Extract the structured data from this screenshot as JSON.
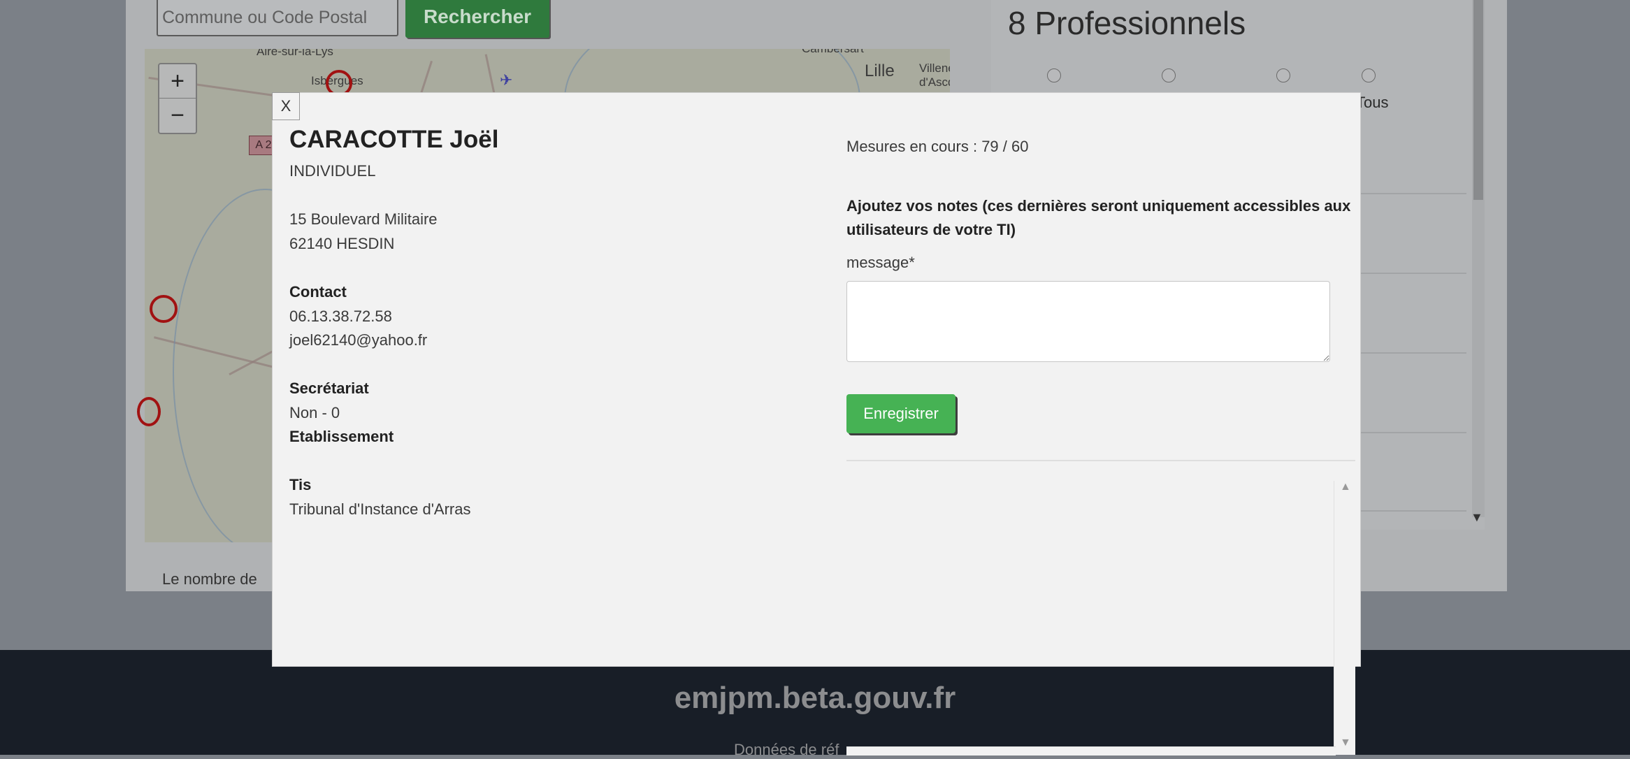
{
  "search": {
    "placeholder": "Commune ou Code Postal",
    "button_label": "Rechercher"
  },
  "map": {
    "zoom_in": "+",
    "zoom_out": "−",
    "road_sign": "A 2",
    "places": [
      "Aire-sur-la-Lys",
      "Isbergues",
      "Lille",
      "Villeneuve-d'Ascq",
      "Cambersart"
    ]
  },
  "below_map_text": "Le nombre de",
  "right_panel": {
    "title": "8 Professionnels",
    "radio_last_label": "Tous"
  },
  "footer": {
    "title": "emjpm.beta.gouv.fr",
    "subtitle": "Données de réf"
  },
  "modal": {
    "close_label": "X",
    "name": "CARACOTTE Joël",
    "type": "INDIVIDUEL",
    "address_line1": "15 Boulevard Militaire",
    "address_line2": "62140 HESDIN",
    "contact_heading": "Contact",
    "phone": "06.13.38.72.58",
    "email": "joel62140@yahoo.fr",
    "secretariat_heading": "Secrétariat",
    "secretariat_value": "Non - 0",
    "etablissement_heading": "Etablissement",
    "tis_heading": "Tis",
    "tis_value": "Tribunal d'Instance d'Arras",
    "mesures": "Mesures en cours : 79 / 60",
    "notes_heading": "Ajoutez vos notes (ces dernières seront uniquement accessibles aux utilisateurs de votre TI)",
    "message_label": "message*",
    "message_value": "",
    "save_label": "Enregistrer"
  }
}
